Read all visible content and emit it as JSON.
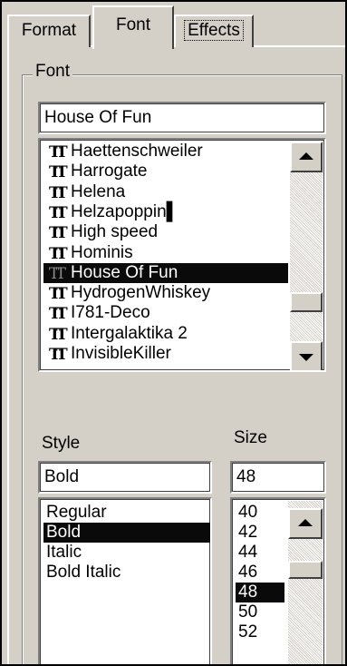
{
  "tabs": [
    {
      "label": "Format"
    },
    {
      "label": "Font"
    },
    {
      "label": "Effects"
    }
  ],
  "font_group": {
    "title": "Font",
    "value": "House Of Fun",
    "list_icon": "truetype-icon",
    "items": [
      {
        "name": "Haettenschweiler"
      },
      {
        "name": "Harrogate"
      },
      {
        "name": "Helena"
      },
      {
        "name": "Helzapoppin▌"
      },
      {
        "name": "High speed"
      },
      {
        "name": "Hominis"
      },
      {
        "name": "House Of Fun"
      },
      {
        "name": "HydrogenWhiskey"
      },
      {
        "name": "I781-Deco"
      },
      {
        "name": "Intergalaktika 2"
      },
      {
        "name": "InvisibleKiller"
      }
    ],
    "selected": "House Of Fun"
  },
  "style": {
    "label": "Style",
    "value": "Bold",
    "items": [
      "Regular",
      "Bold",
      "Italic",
      "Bold Italic"
    ],
    "selected": "Bold"
  },
  "size": {
    "label": "Size",
    "value": "48",
    "items": [
      "40",
      "42",
      "44",
      "46",
      "48",
      "50",
      "52"
    ],
    "selected": "48"
  },
  "colors": {
    "face": "#d4d0c8",
    "selection": "#0a0a0a"
  }
}
